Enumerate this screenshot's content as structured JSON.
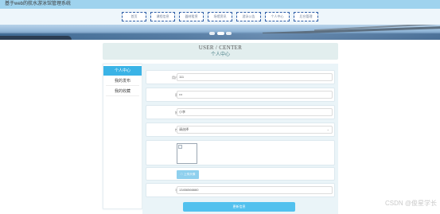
{
  "site": {
    "title": "基于web的航水游泳馆管理系统"
  },
  "nav": {
    "items": [
      {
        "label": "首页"
      },
      {
        "label": "课程信息"
      },
      {
        "label": "器材租赁"
      },
      {
        "label": "场馆资讯"
      },
      {
        "label": "游泳公告"
      },
      {
        "label": "个人中心"
      },
      {
        "label": "后台管理"
      }
    ]
  },
  "banner": {
    "slides": 3,
    "active_slide": 1
  },
  "header": {
    "en": "USER / CENTER",
    "cn": "个人中心"
  },
  "sidebar": {
    "items": [
      {
        "label": "个人中心",
        "active": true
      },
      {
        "label": "我的发布",
        "active": false
      },
      {
        "label": "我的收藏",
        "active": false
      }
    ]
  },
  "form": {
    "username": {
      "label": "用户名",
      "value": "111"
    },
    "password": {
      "label": "密码",
      "value": "•••"
    },
    "name": {
      "label": "姓名",
      "value": "小李"
    },
    "gender": {
      "label": "性别",
      "value": "请选择"
    },
    "upload": {
      "label": "上传头像"
    },
    "phone": {
      "label": "手机",
      "value": "13456566660"
    },
    "submit": {
      "label": "更新信息"
    }
  },
  "watermark": "CSDN @俊星学长",
  "colors": {
    "accent": "#3ab3e6",
    "title_bar": "#9fd3ee",
    "nav_border": "#2f5fa8"
  }
}
